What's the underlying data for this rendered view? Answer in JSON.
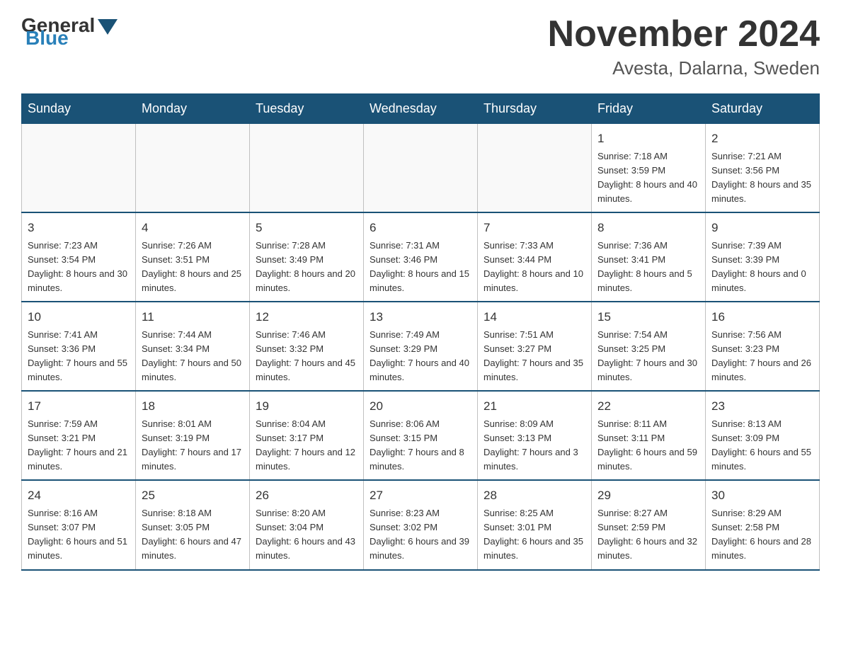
{
  "header": {
    "logo": {
      "general": "General",
      "blue": "Blue"
    },
    "title": "November 2024",
    "location": "Avesta, Dalarna, Sweden"
  },
  "days_of_week": [
    "Sunday",
    "Monday",
    "Tuesday",
    "Wednesday",
    "Thursday",
    "Friday",
    "Saturday"
  ],
  "weeks": [
    [
      {
        "day": "",
        "info": ""
      },
      {
        "day": "",
        "info": ""
      },
      {
        "day": "",
        "info": ""
      },
      {
        "day": "",
        "info": ""
      },
      {
        "day": "",
        "info": ""
      },
      {
        "day": "1",
        "info": "Sunrise: 7:18 AM\nSunset: 3:59 PM\nDaylight: 8 hours\nand 40 minutes."
      },
      {
        "day": "2",
        "info": "Sunrise: 7:21 AM\nSunset: 3:56 PM\nDaylight: 8 hours\nand 35 minutes."
      }
    ],
    [
      {
        "day": "3",
        "info": "Sunrise: 7:23 AM\nSunset: 3:54 PM\nDaylight: 8 hours\nand 30 minutes."
      },
      {
        "day": "4",
        "info": "Sunrise: 7:26 AM\nSunset: 3:51 PM\nDaylight: 8 hours\nand 25 minutes."
      },
      {
        "day": "5",
        "info": "Sunrise: 7:28 AM\nSunset: 3:49 PM\nDaylight: 8 hours\nand 20 minutes."
      },
      {
        "day": "6",
        "info": "Sunrise: 7:31 AM\nSunset: 3:46 PM\nDaylight: 8 hours\nand 15 minutes."
      },
      {
        "day": "7",
        "info": "Sunrise: 7:33 AM\nSunset: 3:44 PM\nDaylight: 8 hours\nand 10 minutes."
      },
      {
        "day": "8",
        "info": "Sunrise: 7:36 AM\nSunset: 3:41 PM\nDaylight: 8 hours\nand 5 minutes."
      },
      {
        "day": "9",
        "info": "Sunrise: 7:39 AM\nSunset: 3:39 PM\nDaylight: 8 hours\nand 0 minutes."
      }
    ],
    [
      {
        "day": "10",
        "info": "Sunrise: 7:41 AM\nSunset: 3:36 PM\nDaylight: 7 hours\nand 55 minutes."
      },
      {
        "day": "11",
        "info": "Sunrise: 7:44 AM\nSunset: 3:34 PM\nDaylight: 7 hours\nand 50 minutes."
      },
      {
        "day": "12",
        "info": "Sunrise: 7:46 AM\nSunset: 3:32 PM\nDaylight: 7 hours\nand 45 minutes."
      },
      {
        "day": "13",
        "info": "Sunrise: 7:49 AM\nSunset: 3:29 PM\nDaylight: 7 hours\nand 40 minutes."
      },
      {
        "day": "14",
        "info": "Sunrise: 7:51 AM\nSunset: 3:27 PM\nDaylight: 7 hours\nand 35 minutes."
      },
      {
        "day": "15",
        "info": "Sunrise: 7:54 AM\nSunset: 3:25 PM\nDaylight: 7 hours\nand 30 minutes."
      },
      {
        "day": "16",
        "info": "Sunrise: 7:56 AM\nSunset: 3:23 PM\nDaylight: 7 hours\nand 26 minutes."
      }
    ],
    [
      {
        "day": "17",
        "info": "Sunrise: 7:59 AM\nSunset: 3:21 PM\nDaylight: 7 hours\nand 21 minutes."
      },
      {
        "day": "18",
        "info": "Sunrise: 8:01 AM\nSunset: 3:19 PM\nDaylight: 7 hours\nand 17 minutes."
      },
      {
        "day": "19",
        "info": "Sunrise: 8:04 AM\nSunset: 3:17 PM\nDaylight: 7 hours\nand 12 minutes."
      },
      {
        "day": "20",
        "info": "Sunrise: 8:06 AM\nSunset: 3:15 PM\nDaylight: 7 hours\nand 8 minutes."
      },
      {
        "day": "21",
        "info": "Sunrise: 8:09 AM\nSunset: 3:13 PM\nDaylight: 7 hours\nand 3 minutes."
      },
      {
        "day": "22",
        "info": "Sunrise: 8:11 AM\nSunset: 3:11 PM\nDaylight: 6 hours\nand 59 minutes."
      },
      {
        "day": "23",
        "info": "Sunrise: 8:13 AM\nSunset: 3:09 PM\nDaylight: 6 hours\nand 55 minutes."
      }
    ],
    [
      {
        "day": "24",
        "info": "Sunrise: 8:16 AM\nSunset: 3:07 PM\nDaylight: 6 hours\nand 51 minutes."
      },
      {
        "day": "25",
        "info": "Sunrise: 8:18 AM\nSunset: 3:05 PM\nDaylight: 6 hours\nand 47 minutes."
      },
      {
        "day": "26",
        "info": "Sunrise: 8:20 AM\nSunset: 3:04 PM\nDaylight: 6 hours\nand 43 minutes."
      },
      {
        "day": "27",
        "info": "Sunrise: 8:23 AM\nSunset: 3:02 PM\nDaylight: 6 hours\nand 39 minutes."
      },
      {
        "day": "28",
        "info": "Sunrise: 8:25 AM\nSunset: 3:01 PM\nDaylight: 6 hours\nand 35 minutes."
      },
      {
        "day": "29",
        "info": "Sunrise: 8:27 AM\nSunset: 2:59 PM\nDaylight: 6 hours\nand 32 minutes."
      },
      {
        "day": "30",
        "info": "Sunrise: 8:29 AM\nSunset: 2:58 PM\nDaylight: 6 hours\nand 28 minutes."
      }
    ]
  ]
}
